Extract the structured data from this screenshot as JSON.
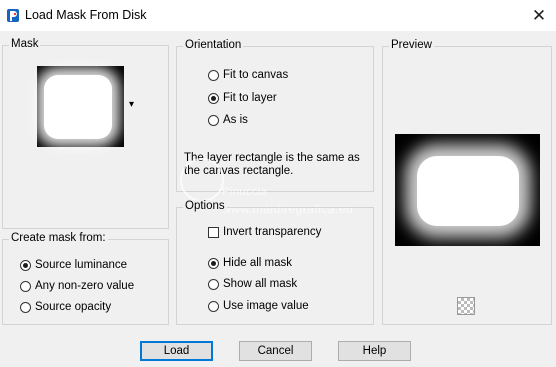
{
  "window": {
    "title": "Load Mask From Disk",
    "close_glyph": "✕",
    "icon": "paint-shop-icon"
  },
  "mask_group": {
    "label": "Mask",
    "dropdown_glyph": "▾"
  },
  "create_mask_group": {
    "label": "Create mask from:",
    "options": [
      {
        "label": "Source luminance",
        "selected": true
      },
      {
        "label": "Any non-zero value",
        "selected": false
      },
      {
        "label": "Source opacity",
        "selected": false
      }
    ]
  },
  "orientation_group": {
    "label": "Orientation",
    "options": [
      {
        "label": "Fit to canvas",
        "selected": false
      },
      {
        "label": "Fit to layer",
        "selected": true
      },
      {
        "label": "As is",
        "selected": false
      }
    ],
    "info_line1": "The layer rectangle is the same as",
    "info_line2": "the canvas rectangle."
  },
  "options_group": {
    "label": "Options",
    "invert_label": "Invert transparency",
    "invert_checked": false,
    "mask_options": [
      {
        "label": "Hide all mask",
        "selected": true
      },
      {
        "label": "Show all mask",
        "selected": false
      },
      {
        "label": "Use image value",
        "selected": false
      }
    ]
  },
  "preview_group": {
    "label": "Preview"
  },
  "watermark": {
    "name": "Pinuccia",
    "url": "www.maidiregrafica.eu"
  },
  "buttons": {
    "load": "Load",
    "cancel": "Cancel",
    "help": "Help"
  },
  "colors": {
    "dialog_bg": "#f0f0f0",
    "accent": "#0078d7"
  }
}
